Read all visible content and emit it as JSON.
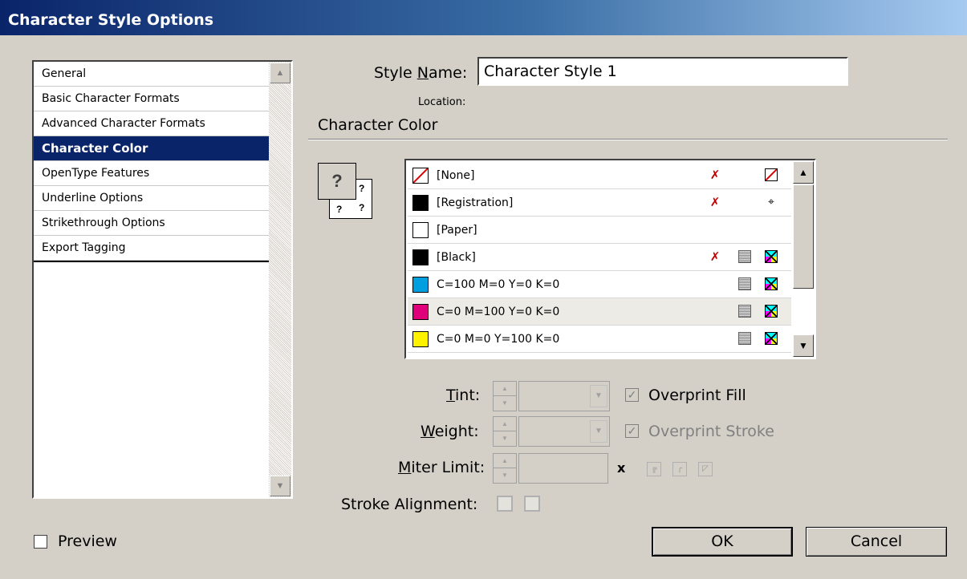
{
  "window": {
    "title": "Character Style Options"
  },
  "categories": [
    "General",
    "Basic Character Formats",
    "Advanced Character Formats",
    "Character Color",
    "OpenType Features",
    "Underline Options",
    "Strikethrough Options",
    "Export Tagging"
  ],
  "selected_category": "Character Color",
  "style_name": {
    "label_pre": "Style ",
    "label_u": "N",
    "label_post": "ame:",
    "value": "Character Style 1"
  },
  "location_label": "Location:",
  "section_title": "Character Color",
  "swatches": [
    {
      "name": "[None]",
      "color": "#ffffff"
    },
    {
      "name": "[Registration]",
      "color": "#000000"
    },
    {
      "name": "[Paper]",
      "color": "#ffffff"
    },
    {
      "name": "[Black]",
      "color": "#000000"
    },
    {
      "name": "C=100 M=0 Y=0 K=0",
      "color": "#00a0e0"
    },
    {
      "name": "C=0 M=100 Y=0 K=0",
      "color": "#e0007a"
    },
    {
      "name": "C=0 M=0 Y=100 K=0",
      "color": "#fff200"
    }
  ],
  "proxy_glyph": "?",
  "tint": {
    "label_u": "T",
    "label_post": "int:",
    "value": ""
  },
  "weight": {
    "label_u": "W",
    "label_post": "eight:",
    "value": ""
  },
  "miter": {
    "label_u": "M",
    "label_post": "iter Limit:",
    "value": "",
    "unit": "x"
  },
  "overprint_fill": {
    "label": "Overprint Fill",
    "checked": true
  },
  "overprint_stroke": {
    "label": "Overprint Stroke",
    "checked": true
  },
  "stroke_alignment_label": "Stroke Alignment:",
  "preview": {
    "label": "Preview",
    "checked": false
  },
  "buttons": {
    "ok": "OK",
    "cancel": "Cancel"
  },
  "check_glyph": "✓"
}
